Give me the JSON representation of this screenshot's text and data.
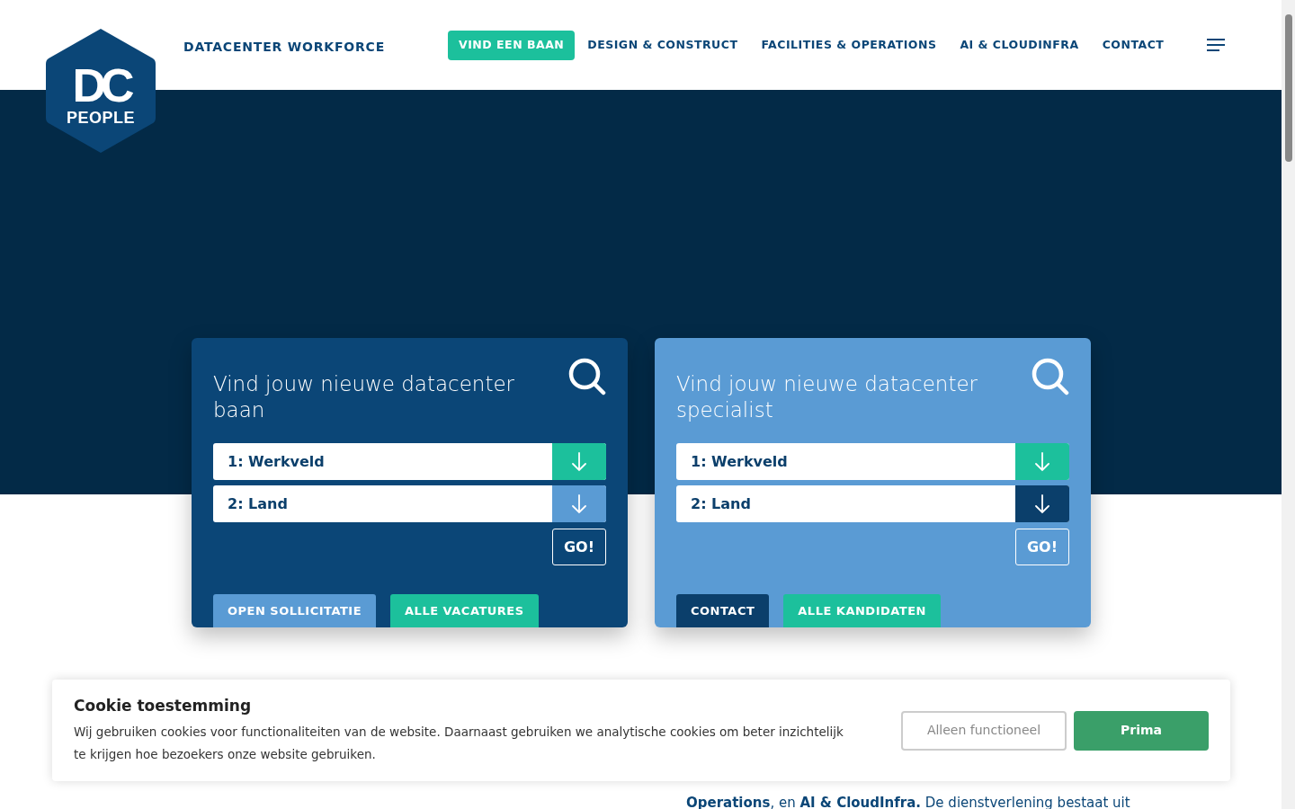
{
  "header": {
    "logo": {
      "letters": "DC",
      "word": "PEOPLE"
    },
    "tagline": "DATACENTER WORKFORCE",
    "nav": [
      {
        "label": "VIND EEN BAAN",
        "selected": true
      },
      {
        "label": "DESIGN & CONSTRUCT",
        "selected": false
      },
      {
        "label": "FACILITIES & OPERATIONS",
        "selected": false
      },
      {
        "label": "AI & CLOUDINFRA",
        "selected": false
      },
      {
        "label": "CONTACT",
        "selected": false
      }
    ]
  },
  "search_cards": [
    {
      "title": "Vind jouw nieuwe datacenter baan",
      "color": "#0b4677",
      "selects": [
        {
          "label": "1: Werkveld",
          "color": "#1cc09c"
        },
        {
          "label": "2: Land",
          "color": "#5a9bd4"
        }
      ],
      "go": "GO!",
      "buttons": [
        {
          "label": "OPEN SOLLICITATIE",
          "color": "#5a9bd4"
        },
        {
          "label": "ALLE VACATURES",
          "color": "#1cc09c"
        }
      ]
    },
    {
      "title": "Vind jouw nieuwe datacenter specialist",
      "color": "#5a9bd4",
      "selects": [
        {
          "label": "1: Werkveld",
          "color": "#1cc09c"
        },
        {
          "label": "2: Land",
          "color": "#0b3f6b"
        }
      ],
      "go": "GO!",
      "buttons": [
        {
          "label": "CONTACT",
          "color": "#0b3f6b"
        },
        {
          "label": "ALLE KANDIDATEN",
          "color": "#1cc09c"
        }
      ]
    }
  ],
  "intro": {
    "text_fragment": "**Operations**, en **AI & CloudInfra.** De dienstverlening bestaat uit"
  },
  "cookie_banner": {
    "title": "Cookie toestemming",
    "text": "Wij gebruiken cookies voor functionaliteiten van de website. Daarnaast gebruiken we analytische cookies om beter inzichtelijk te krijgen hoe bezoekers onze website gebruiken.",
    "decline": "Alleen functioneel",
    "accept": "Prima"
  }
}
